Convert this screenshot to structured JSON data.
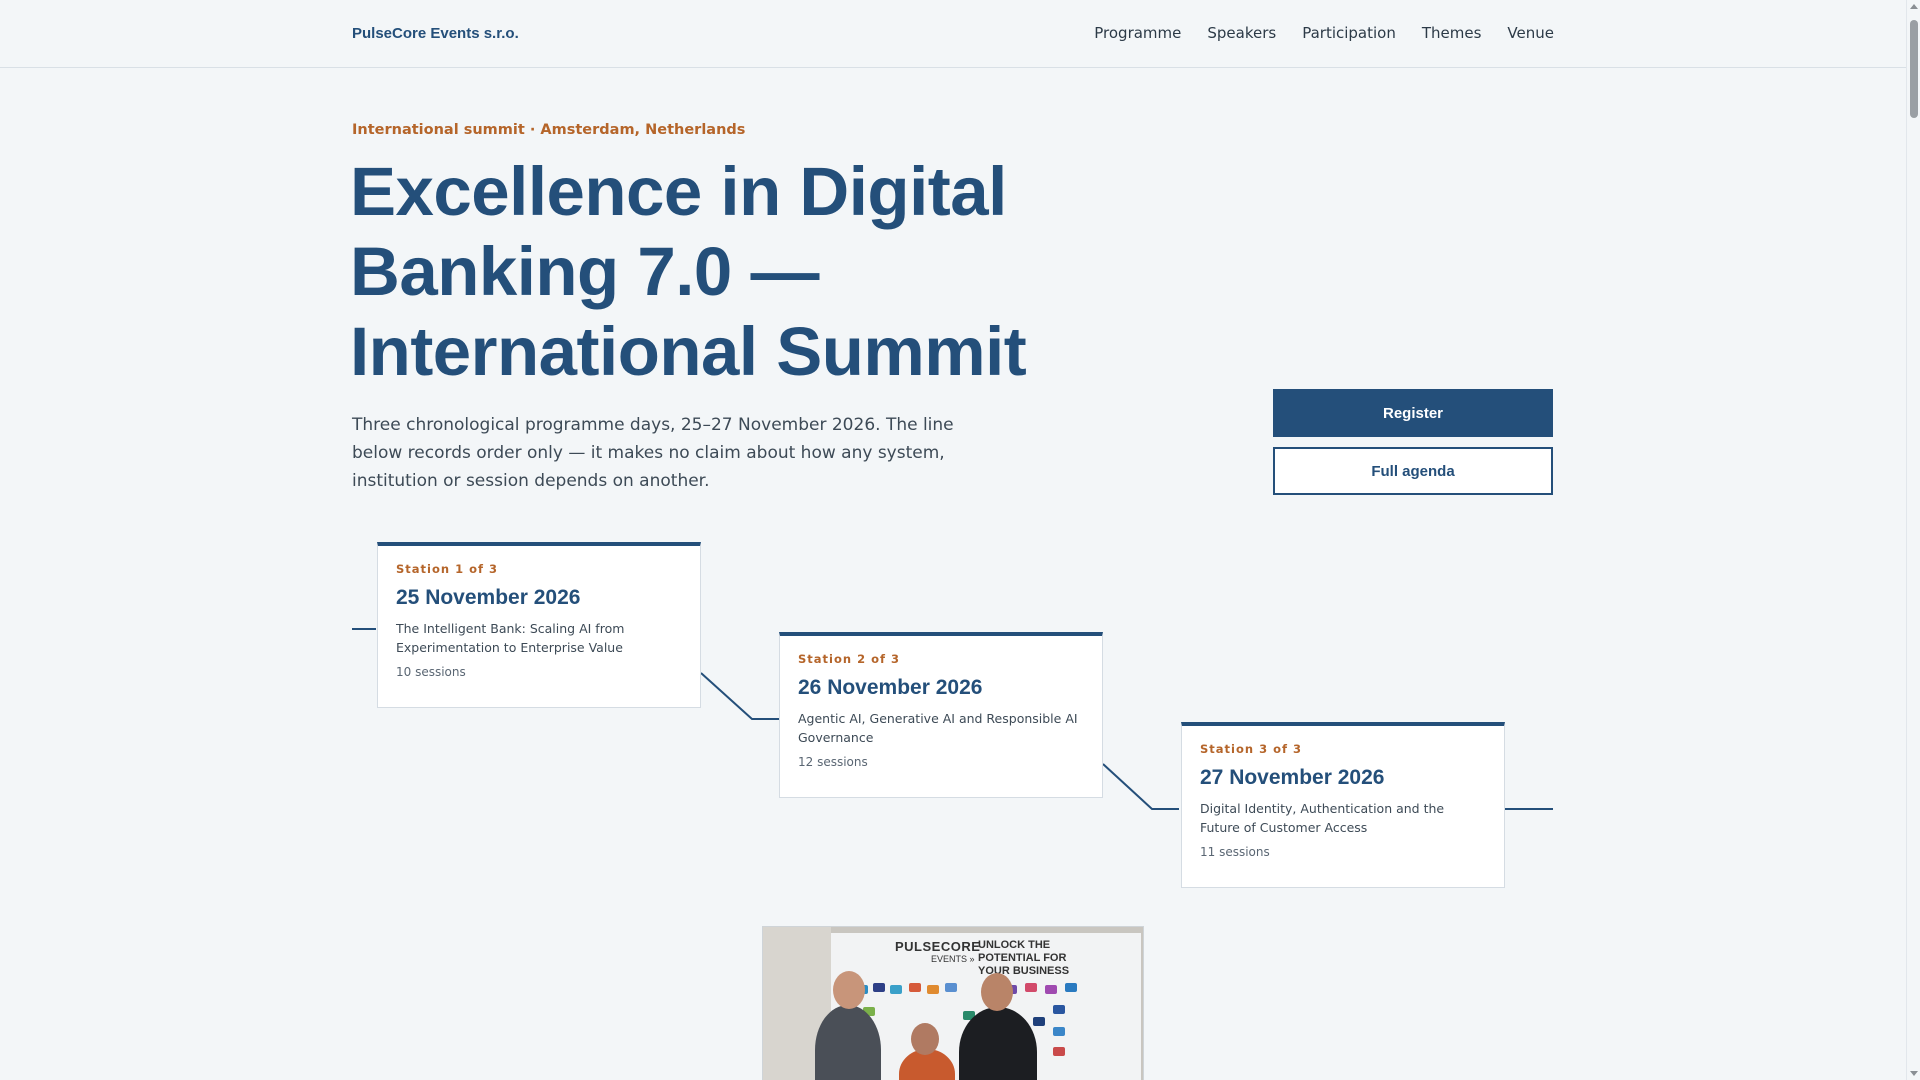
{
  "header": {
    "brand": "PulseCore Events s.r.o.",
    "nav": [
      "Programme",
      "Speakers",
      "Participation",
      "Themes",
      "Venue"
    ]
  },
  "hero": {
    "eyebrow": "International summit · Amsterdam, Netherlands",
    "title": "Excellence in Digital Banking 7.0 — International Summit",
    "lead": "Three chronological programme days, 25–27 November 2026. The line below records order only — it makes no claim about how any system, institution or session depends on another.",
    "register_label": "Register",
    "agenda_label": "Full agenda"
  },
  "stations": [
    {
      "kicker": "Station 1 of 3",
      "date": "25 November 2026",
      "theme": "The Intelligent Bank: Scaling AI from Experimentation to Enterprise Value",
      "count": "10 sessions"
    },
    {
      "kicker": "Station 2 of 3",
      "date": "26 November 2026",
      "theme": "Agentic AI, Generative AI and Responsible AI Governance",
      "count": "12 sessions"
    },
    {
      "kicker": "Station 3 of 3",
      "date": "27 November 2026",
      "theme": "Digital Identity, Authentication and the Future of Customer Access",
      "count": "11 sessions"
    }
  ],
  "photo": {
    "brand": "PULSECORE",
    "brand_sub": "EVENTS »",
    "tagline": "UNLOCK THE POTENTIAL FOR YOUR BUSINESS"
  },
  "colors": {
    "primary": "#244f7a",
    "accent": "#b5652a",
    "background": "#f3f6f8"
  }
}
